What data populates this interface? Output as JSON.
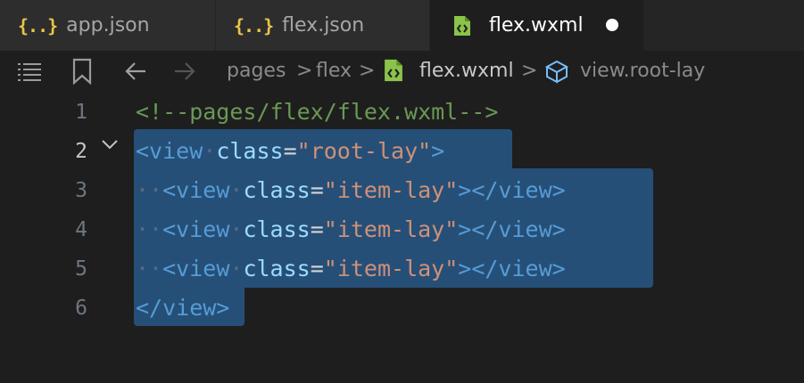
{
  "tabs": [
    {
      "label": "app.json",
      "icon": "json-braces-icon",
      "icon_text": "{..}",
      "active": false
    },
    {
      "label": "flex.json",
      "icon": "json-braces-icon",
      "icon_text": "{..}",
      "active": false
    },
    {
      "label": "flex.wxml",
      "icon": "wxml-file-icon",
      "active": true,
      "modified": true
    }
  ],
  "breadcrumb": {
    "items": [
      "pages",
      "flex",
      "flex.wxml",
      "view.root-lay"
    ],
    "separator": ">"
  },
  "editor": {
    "current_line": 2,
    "line_numbers": [
      "1",
      "2",
      "3",
      "4",
      "5",
      "6"
    ],
    "lines": [
      {
        "comment": "<!--pages/flex/flex.wxml-->"
      },
      {
        "open": "<view",
        "attr": "class",
        "eq": "=",
        "value": "\"root-lay\"",
        "close": ">"
      },
      {
        "open": "<view",
        "attr": "class",
        "eq": "=",
        "value": "\"item-lay\"",
        "close": "></view>"
      },
      {
        "open": "<view",
        "attr": "class",
        "eq": "=",
        "value": "\"item-lay\"",
        "close": "></view>"
      },
      {
        "open": "<view",
        "attr": "class",
        "eq": "=",
        "value": "\"item-lay\"",
        "close": "></view>"
      },
      {
        "close_tag": "</view>"
      }
    ]
  },
  "colors": {
    "background": "#1e1e1e",
    "selection": "#264f78",
    "tag": "#569cd6",
    "attribute": "#9cdcfe",
    "string": "#ce9178",
    "comment": "#6a9955",
    "json_icon": "#e8c547",
    "wxml_icon": "#8bc34a"
  }
}
